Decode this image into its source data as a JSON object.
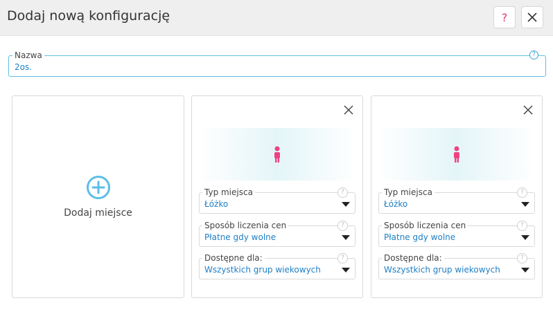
{
  "dialog": {
    "title": "Dodaj nową konfigurację",
    "help_label": "?",
    "help_icon": "question-icon",
    "close_icon": "close-icon"
  },
  "name_field": {
    "label": "Nazwa",
    "value": "2os.",
    "help_label": "?"
  },
  "add_card": {
    "label": "Dodaj miejsce",
    "icon": "plus-circle-icon",
    "color": "#5bbde8"
  },
  "places": [
    {
      "icon": "person-icon",
      "icon_color": "#f0427f",
      "fields": [
        {
          "label": "Typ miejsca",
          "value": "Łóżko",
          "help": "?"
        },
        {
          "label": "Sposób liczenia cen",
          "value": "Płatne gdy wolne",
          "help": "?"
        },
        {
          "label": "Dostępne dla:",
          "value": "Wszystkich grup wiekowych",
          "help": "?"
        }
      ]
    },
    {
      "icon": "person-icon",
      "icon_color": "#f0427f",
      "fields": [
        {
          "label": "Typ miejsca",
          "value": "Łóżko",
          "help": "?"
        },
        {
          "label": "Sposób liczenia cen",
          "value": "Płatne gdy wolne",
          "help": "?"
        },
        {
          "label": "Dostępne dla:",
          "value": "Wszystkich grup wiekowych",
          "help": "?"
        }
      ]
    }
  ],
  "colors": {
    "accent": "#1e7fc4",
    "input_focus_border": "#5bc0de",
    "help_pink": "#e8336b"
  }
}
